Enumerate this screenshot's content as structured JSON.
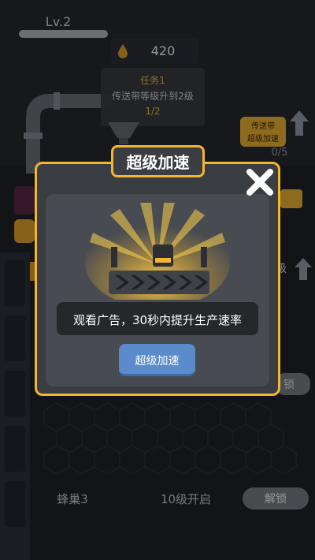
{
  "header": {
    "level_label": "Lv.2",
    "resource_value": "420",
    "resource_icon": "oil-drop-icon"
  },
  "task": {
    "title": "任务1",
    "description": "传送带等级升到2级",
    "progress": "1/2"
  },
  "conveyor_upgrade": {
    "line1": "传送带",
    "line2": "超级加速",
    "count": "0/5"
  },
  "side": {
    "partial_text": "级"
  },
  "hive": {
    "name": "蜂巢3",
    "requirement": "10级开启",
    "unlock_label": "解锁",
    "unlock_label_2": "锁"
  },
  "modal": {
    "title": "超级加速",
    "description": "观看广告，30秒内提升生产速率",
    "action_label": "超级加速",
    "close_icon": "close-icon"
  },
  "colors": {
    "accent_yellow": "#f2b630",
    "button_blue": "#5b8bcb",
    "panel_dark": "#3a3d42"
  }
}
